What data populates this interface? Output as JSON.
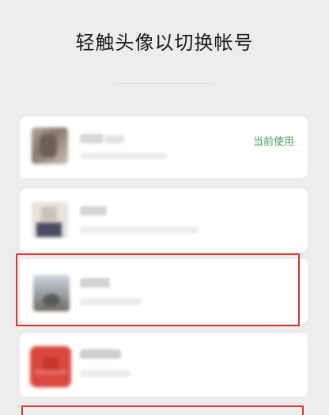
{
  "page_title": "轻触头像以切换帐号",
  "accounts": [
    {
      "status": "当前使用",
      "is_current": true
    },
    {
      "status": "",
      "is_current": false
    },
    {
      "status": "",
      "is_current": false,
      "highlighted": true
    },
    {
      "status": "",
      "is_current": false
    }
  ],
  "colors": {
    "background": "#ededed",
    "card": "#ffffff",
    "status_text": "#46a05c",
    "highlight_border": "#d9342e"
  }
}
